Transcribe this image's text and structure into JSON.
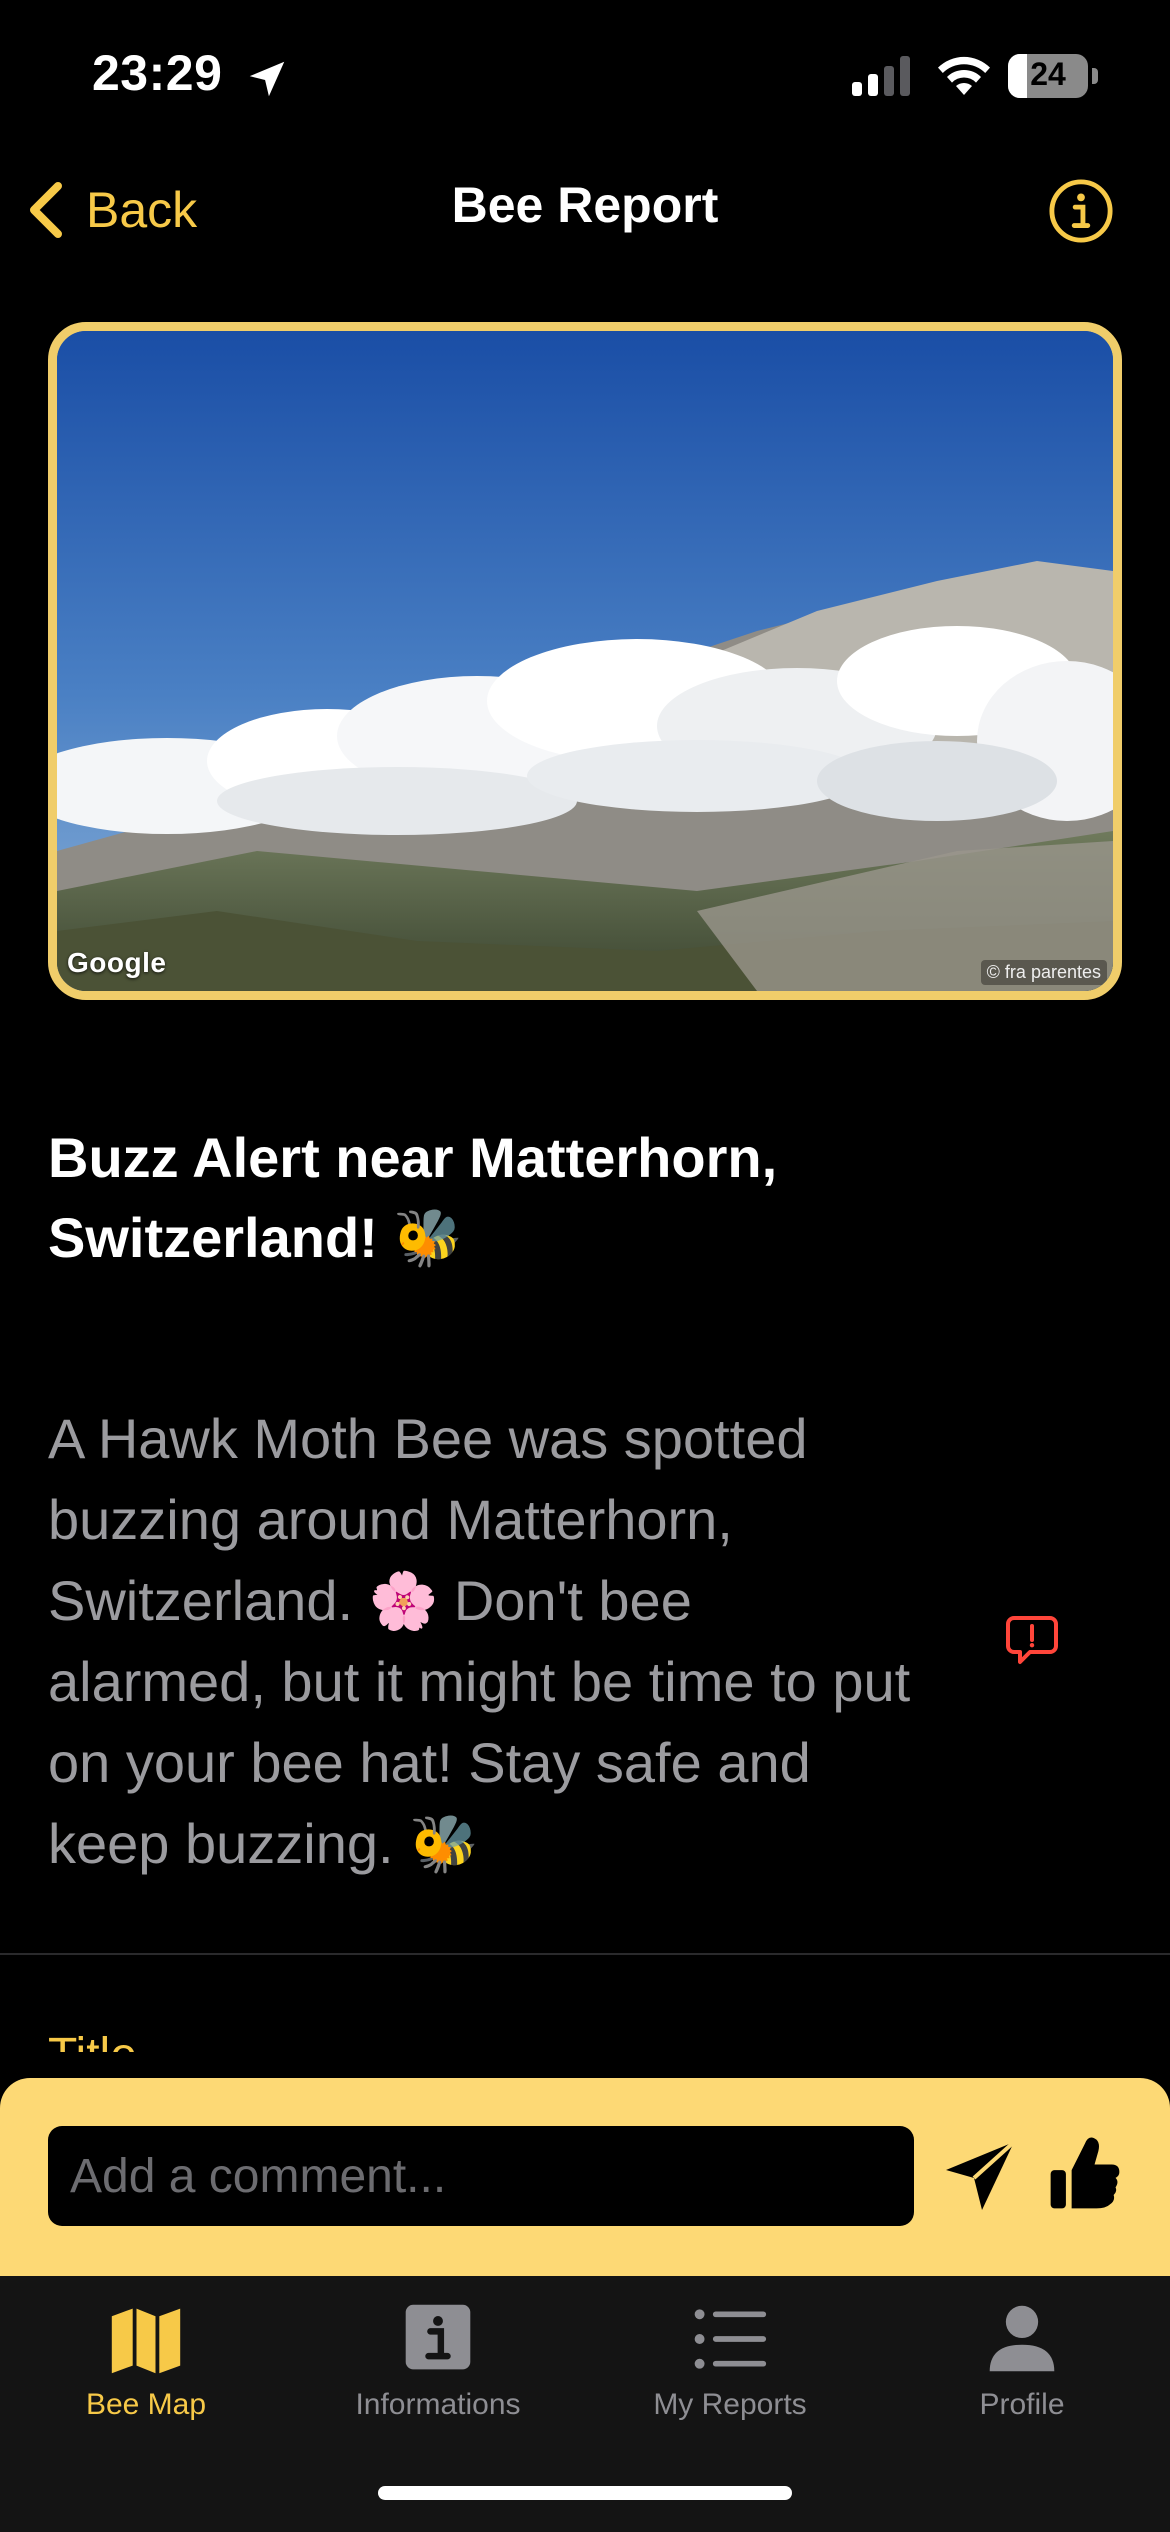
{
  "status_bar": {
    "time": "23:29",
    "battery": "24",
    "battery_fraction": 0.24
  },
  "nav": {
    "back_label": "Back",
    "title": "Bee Report"
  },
  "photo": {
    "attribution_logo": "Google",
    "credit": "© fra parentes"
  },
  "report": {
    "title": "Buzz Alert near Matterhorn, Switzerland! 🐝",
    "description": "A Hawk Moth Bee was spotted buzzing around Matterhorn, Switzerland. 🌸 Don't bee alarmed, but it might be time to put on your bee hat! Stay safe and keep buzzing. 🐝",
    "next_section_label": "Title"
  },
  "comment": {
    "placeholder": "Add a comment..."
  },
  "tabs": [
    {
      "label": "Bee Map",
      "icon": "map-icon",
      "active": true
    },
    {
      "label": "Informations",
      "icon": "info-square-icon",
      "active": false
    },
    {
      "label": "My Reports",
      "icon": "list-icon",
      "active": false
    },
    {
      "label": "Profile",
      "icon": "person-icon",
      "active": false
    }
  ],
  "colors": {
    "accent": "#f7c948",
    "comment_bar": "#fdd975",
    "photo_border": "#f0cd6a",
    "flag_icon": "#ff453a"
  }
}
